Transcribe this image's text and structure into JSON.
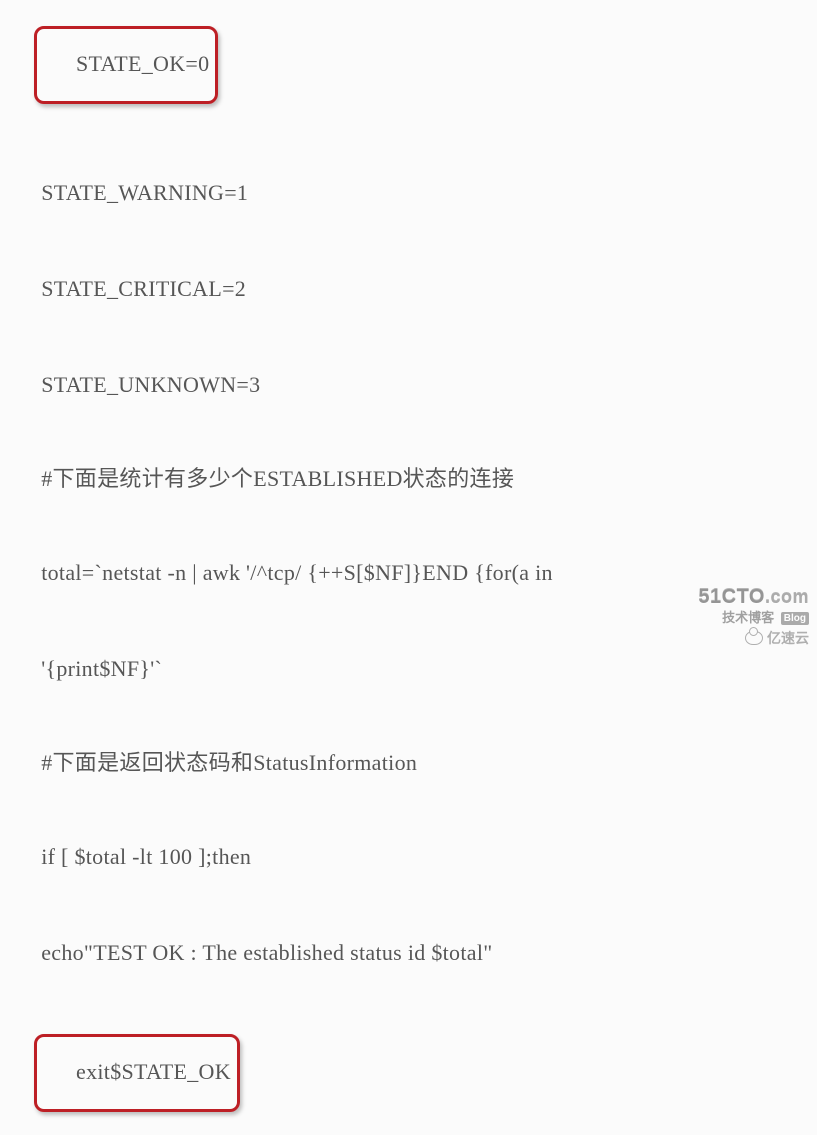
{
  "code": {
    "lines": [
      "STATE_OK=0",
      "STATE_WARNING=1",
      "STATE_CRITICAL=2",
      "STATE_UNKNOWN=3",
      "#下面是统计有多少个ESTABLISHED状态的连接",
      "total=`netstat -n | awk '/^tcp/ {++S[$NF]}END {for(a in",
      "'{print$NF}'`",
      "#下面是返回状态码和StatusInformation",
      "if [ $total -lt 100 ];then",
      "echo\"TEST OK : The established status id $total\"",
      "exit$STATE_OK"
    ],
    "highlighted_indices": [
      0,
      10
    ]
  },
  "watermarks": {
    "primary_brand": "51CTO",
    "primary_suffix": ".com",
    "primary_tag_cn": "技术博客",
    "primary_tag_en": "Blog",
    "secondary": "亿速云"
  }
}
